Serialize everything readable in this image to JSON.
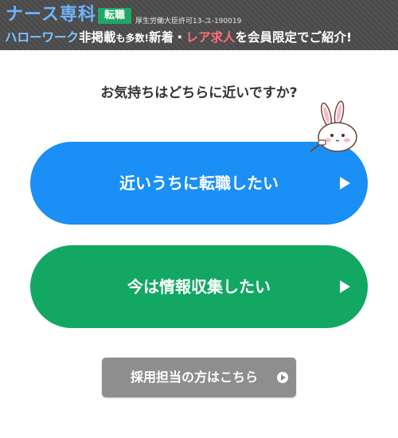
{
  "header": {
    "brand": "ナース専科",
    "badge": "転職",
    "license": "厚生労働大臣許可13-ユ-190019",
    "tagline": {
      "part1": "ハローワーク",
      "part2": "非掲載",
      "part3": "も多数!",
      "part4": "新着・",
      "part5": "レア求人",
      "part6": "を会員限定でご紹介!"
    }
  },
  "question": "お気持ちはどちらに近いですか?",
  "choices": [
    {
      "label": "近いうちに転職したい",
      "color": "#1a8ff5"
    },
    {
      "label": "今は情報収集したい",
      "color": "#12a863"
    }
  ],
  "mascot": "rabbit-mascot-icon",
  "recruiter_button": {
    "label": "採用担当の方はこちら"
  }
}
